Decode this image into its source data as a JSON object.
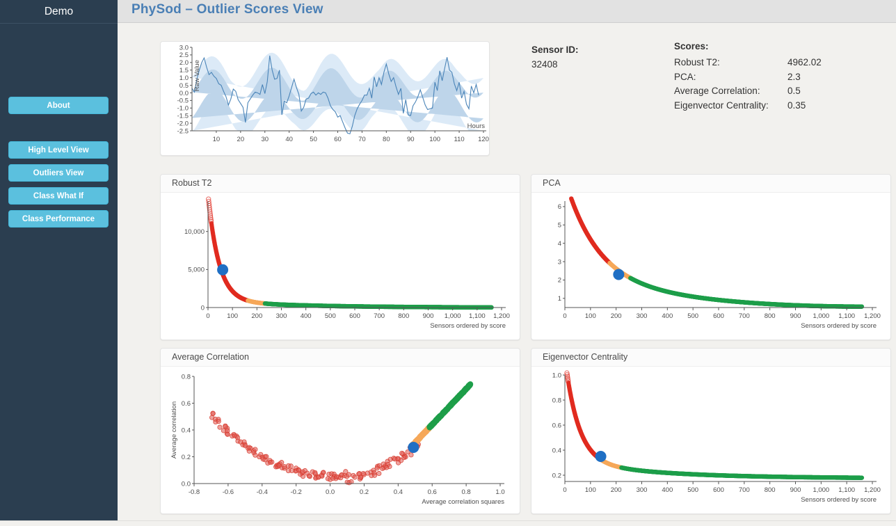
{
  "app": {
    "brand": "Demo",
    "page_title": "PhySod – Outlier Scores View"
  },
  "sidebar": {
    "items": [
      {
        "id": "about",
        "label": "About"
      },
      {
        "id": "high-level-view",
        "label": "High Level View"
      },
      {
        "id": "outliers-view",
        "label": "Outliers View"
      },
      {
        "id": "class-what-if",
        "label": "Class What If"
      },
      {
        "id": "class-performance",
        "label": "Class Performance"
      }
    ],
    "colors": {
      "background": "#2b3e50",
      "button": "#5bc0de",
      "button_text": "#ffffff"
    }
  },
  "sensor": {
    "heading": "Sensor ID:",
    "value": "32408"
  },
  "scores": {
    "heading": "Scores:",
    "rows": [
      {
        "label": "Robust T2:",
        "value": "4962.02"
      },
      {
        "label": "PCA:",
        "value": "2.3"
      },
      {
        "label": "Average Correlation:",
        "value": "0.5"
      },
      {
        "label": "Eigenvector Centrality:",
        "value": "0.35"
      }
    ]
  },
  "colors": {
    "accent_blue": "#4a7fb5",
    "highlight_point": "#1f6fc4",
    "red": "#e02b20",
    "orange": "#f5a85a",
    "green": "#1e9e4a",
    "raw_line": "#4a84b8",
    "raw_band": "#cfe0f0",
    "page_background": "#f2f1ee",
    "header_background": "#e2e2e2"
  },
  "chart_data": [
    {
      "id": "raw-value",
      "type": "line",
      "title": "",
      "xlabel": "Hours",
      "ylabel": "Raw Value",
      "xlim": [
        0,
        120
      ],
      "ylim": [
        -2.5,
        3.0
      ],
      "xticks": [
        10,
        20,
        30,
        40,
        50,
        60,
        70,
        80,
        90,
        100,
        110,
        120
      ],
      "yticks": [
        3.0,
        2.5,
        2.0,
        1.5,
        1.0,
        0.5,
        0.0,
        -0.5,
        -1.0,
        -1.5,
        -2.0,
        -2.5
      ],
      "grid": false,
      "series": [
        {
          "name": "Raw Value",
          "x": [
            0,
            1,
            2,
            3,
            4,
            5,
            6,
            7,
            8,
            9,
            10,
            11,
            12,
            13,
            14,
            15,
            16,
            17,
            18,
            19,
            20,
            21,
            22,
            23,
            24,
            25,
            26,
            27,
            28,
            29,
            30,
            31,
            32,
            33,
            34,
            35,
            36,
            37,
            38,
            39,
            40,
            41,
            42,
            43,
            44,
            45,
            46,
            47,
            48,
            49,
            50,
            51,
            52,
            53,
            54,
            55,
            56,
            57,
            58,
            59,
            60,
            61,
            62,
            63,
            64,
            65,
            66,
            67,
            68,
            69,
            70,
            71,
            72,
            73,
            74,
            75,
            76,
            77,
            78,
            79,
            80,
            81,
            82,
            83,
            84,
            85,
            86,
            87,
            88,
            89,
            90,
            91,
            92,
            93,
            94,
            95,
            96,
            97,
            98,
            99,
            100,
            101,
            102,
            103,
            104,
            105,
            106,
            107,
            108,
            109,
            110,
            111,
            112,
            113,
            114,
            115,
            116,
            117,
            118,
            119,
            120
          ],
          "values": [
            0.3,
            0.05,
            0.9,
            1.5,
            2.0,
            2.3,
            1.7,
            1.2,
            1.35,
            1.1,
            0.95,
            0.6,
            0.5,
            0.1,
            -0.25,
            -0.8,
            -0.4,
            0.25,
            0.1,
            -0.45,
            -0.7,
            -0.95,
            -1.95,
            -0.65,
            -0.4,
            -0.15,
            0.05,
            0.0,
            -0.1,
            0.55,
            -0.05,
            0.75,
            2.45,
            1.5,
            0.9,
            0.95,
            1.5,
            -1.45,
            -0.55,
            -0.65,
            -0.2,
            0.35,
            0.9,
            0.35,
            -0.1,
            -1.2,
            -0.95,
            -0.4,
            -0.35,
            -0.05,
            0.05,
            -0.15,
            0.0,
            -0.1,
            0.05,
            0.0,
            -0.35,
            -0.85,
            -1.1,
            -1.25,
            -1.6,
            -1.5,
            -1.9,
            -2.3,
            -2.65,
            -2.7,
            -2.2,
            -1.5,
            -1.05,
            -0.75,
            -0.5,
            -0.15,
            -0.15,
            0.3,
            -0.35,
            1.05,
            0.4,
            1.0,
            0.55,
            1.35,
            1.9,
            1.25,
            0.75,
            1.0,
            0.4,
            -0.1,
            0.3,
            -1.35,
            -0.45,
            -1.45,
            -1.5,
            -0.85,
            -0.6,
            -0.25,
            0.2,
            -0.3,
            -0.8,
            -1.1,
            -1.05,
            -1.0,
            0.7,
            0.15,
            1.45,
            0.8,
            1.6,
            2.35,
            1.5,
            1.35,
            0.6,
            0.15,
            0.7,
            -0.35,
            0.1,
            -0.75,
            -1.05,
            0.45,
            0.0,
            0.55,
            -0.15
          ]
        }
      ],
      "bands": [
        {
          "name": "outer",
          "color": "#dceaf7"
        },
        {
          "name": "inner",
          "color": "#bed5ea"
        }
      ]
    },
    {
      "id": "robust-t2",
      "type": "scatter",
      "title": "Robust T2",
      "xlabel": "Sensors ordered by score",
      "ylabel": "",
      "xlim": [
        0,
        1200
      ],
      "ylim": [
        0,
        14000
      ],
      "xticks": [
        0,
        100,
        200,
        300,
        400,
        500,
        600,
        700,
        800,
        900,
        1000,
        1100,
        1200
      ],
      "xticklabels": [
        "0",
        "100",
        "200",
        "300",
        "400",
        "500",
        "600",
        "700",
        "800",
        "900",
        "1,000",
        "1,100",
        "1,200"
      ],
      "yticks": [
        0,
        5000,
        10000
      ],
      "yticklabels": [
        "0",
        "5,000",
        "10,000"
      ],
      "grid": false,
      "curve": "decaying",
      "n_points": 1160,
      "highlight": {
        "x": 60,
        "y": 4962.02,
        "color": "#1f6fc4",
        "label": "selected sensor"
      },
      "color_breaks": [
        {
          "until_frac": 0.14,
          "color": "#e02b20"
        },
        {
          "until_frac": 0.2,
          "color": "#f5a85a"
        },
        {
          "until_frac": 1.0,
          "color": "#1e9e4a"
        }
      ]
    },
    {
      "id": "pca",
      "type": "scatter",
      "title": "PCA",
      "xlabel": "Sensors ordered by score",
      "ylabel": "",
      "xlim": [
        0,
        1200
      ],
      "ylim": [
        0.5,
        6.3
      ],
      "xticks": [
        0,
        100,
        200,
        300,
        400,
        500,
        600,
        700,
        800,
        900,
        1000,
        1100,
        1200
      ],
      "xticklabels": [
        "0",
        "100",
        "200",
        "300",
        "400",
        "500",
        "600",
        "700",
        "800",
        "900",
        "1,000",
        "1,100",
        "1,200"
      ],
      "yticks": [
        1,
        2,
        3,
        4,
        5,
        6
      ],
      "yticklabels": [
        "1",
        "2",
        "3",
        "4",
        "5",
        "6"
      ],
      "grid": false,
      "curve": "decaying",
      "n_points": 1160,
      "highlight": {
        "x": 210,
        "y": 2.3,
        "color": "#1f6fc4",
        "label": "selected sensor"
      },
      "color_breaks": [
        {
          "until_frac": 0.15,
          "color": "#e02b20"
        },
        {
          "until_frac": 0.22,
          "color": "#f5a85a"
        },
        {
          "until_frac": 1.0,
          "color": "#1e9e4a"
        }
      ]
    },
    {
      "id": "average-correlation",
      "type": "scatter",
      "title": "Average Correlation",
      "xlabel": "Average correlation squares",
      "ylabel": "Average correlation",
      "xlim": [
        -0.8,
        1.0
      ],
      "ylim": [
        0.0,
        0.8
      ],
      "xticks": [
        -0.8,
        -0.6,
        -0.4,
        -0.2,
        0.0,
        0.2,
        0.4,
        0.6,
        0.8,
        1.0
      ],
      "xticklabels": [
        "-0.8",
        "-0.6",
        "-0.4",
        "-0.2",
        "0.0",
        "0.2",
        "0.4",
        "0.6",
        "0.8",
        "1.0"
      ],
      "yticks": [
        0.0,
        0.2,
        0.4,
        0.6,
        0.8
      ],
      "yticklabels": [
        "0.0",
        "0.2",
        "0.4",
        "0.6",
        "0.8"
      ],
      "grid": false,
      "curve": "u-shaped",
      "highlight": {
        "x": 0.49,
        "y": 0.27,
        "color": "#1f6fc4",
        "label": "selected sensor"
      },
      "color_breaks": [
        {
          "segment": "left-and-lower",
          "color": "#e02b20"
        },
        {
          "segment": "transition",
          "color": "#f5a85a"
        },
        {
          "segment": "upper-right",
          "color": "#1e9e4a"
        }
      ]
    },
    {
      "id": "eigenvector-centrality",
      "type": "scatter",
      "title": "Eigenvector Centrality",
      "xlabel": "Sensors ordered by score",
      "ylabel": "",
      "xlim": [
        0,
        1200
      ],
      "ylim": [
        0.15,
        1.0
      ],
      "xticks": [
        0,
        100,
        200,
        300,
        400,
        500,
        600,
        700,
        800,
        900,
        1000,
        1100,
        1200
      ],
      "xticklabels": [
        "0",
        "100",
        "200",
        "300",
        "400",
        "500",
        "600",
        "700",
        "800",
        "900",
        "1,000",
        "1,100",
        "1,200"
      ],
      "yticks": [
        0.2,
        0.4,
        0.6,
        0.8,
        1.0
      ],
      "yticklabels": [
        "0.2",
        "0.4",
        "0.6",
        "0.8",
        "1.0"
      ],
      "grid": false,
      "curve": "decaying",
      "n_points": 1160,
      "highlight": {
        "x": 140,
        "y": 0.35,
        "color": "#1f6fc4",
        "label": "selected sensor"
      },
      "color_breaks": [
        {
          "until_frac": 0.125,
          "color": "#e02b20"
        },
        {
          "until_frac": 0.19,
          "color": "#f5a85a"
        },
        {
          "until_frac": 1.0,
          "color": "#1e9e4a"
        }
      ]
    }
  ]
}
